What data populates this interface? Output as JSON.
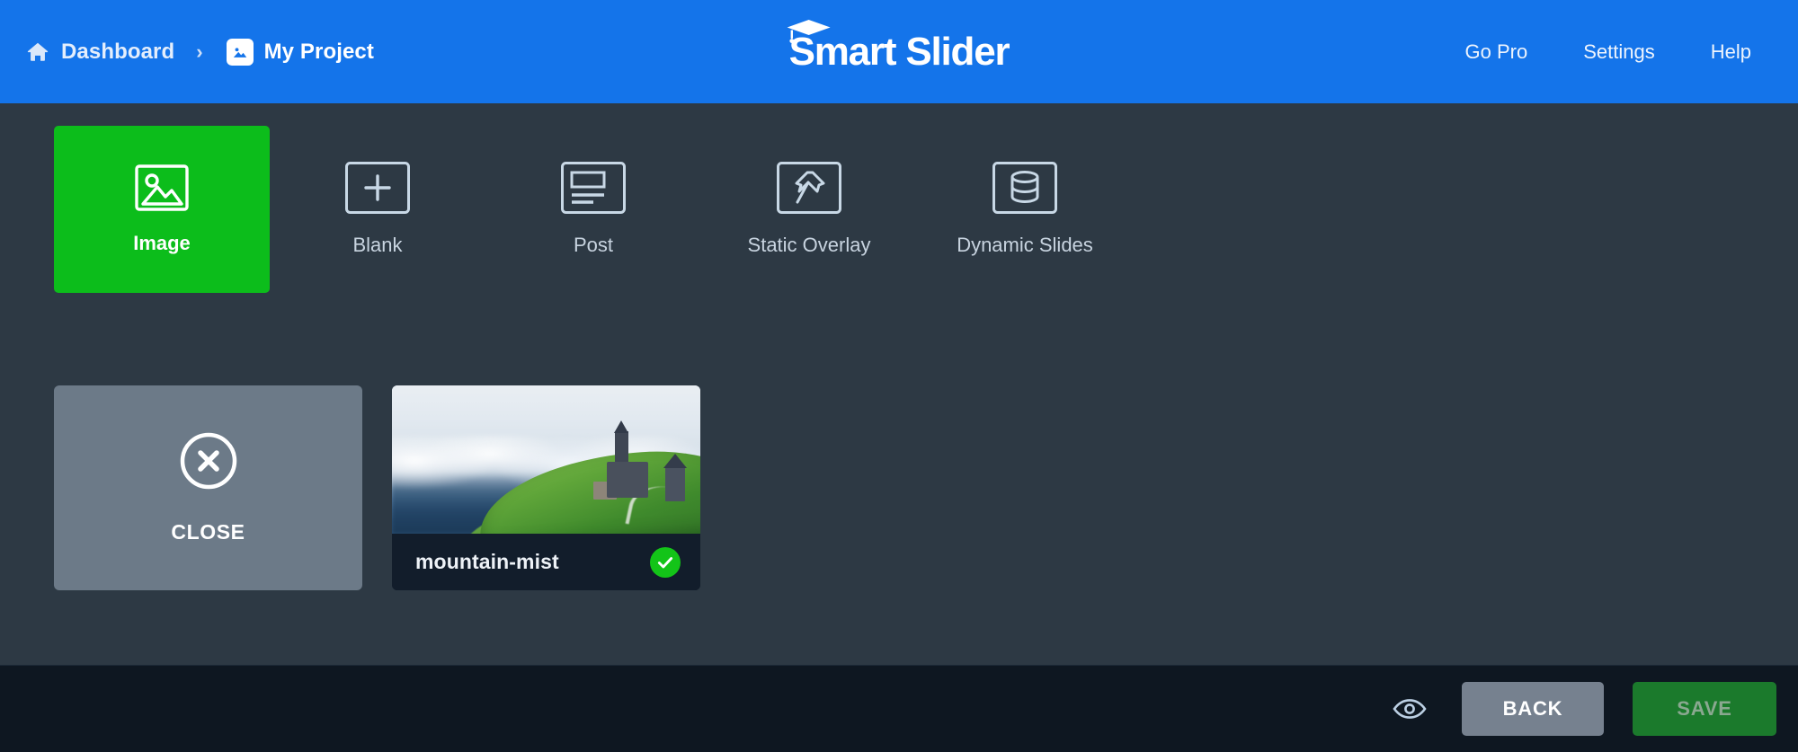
{
  "header": {
    "breadcrumb": {
      "home_icon": "home-icon",
      "home_label": "Dashboard",
      "separator": "›",
      "project_icon": "image-icon",
      "project_label": "My Project"
    },
    "logo": {
      "text": "Smart Slider",
      "cap_icon": "graduation-cap-icon"
    },
    "nav": [
      {
        "label": "Go Pro",
        "name": "go-pro"
      },
      {
        "label": "Settings",
        "name": "settings"
      },
      {
        "label": "Help",
        "name": "help"
      }
    ],
    "colors": {
      "background": "#1474ea",
      "text": "#ffffff"
    }
  },
  "slide_types": [
    {
      "label": "Image",
      "icon": "picture-icon",
      "active": true
    },
    {
      "label": "Blank",
      "icon": "plus-icon",
      "active": false
    },
    {
      "label": "Post",
      "icon": "post-layout-icon",
      "active": false
    },
    {
      "label": "Static Overlay",
      "icon": "pushpin-icon",
      "active": false
    },
    {
      "label": "Dynamic Slides",
      "icon": "database-icon",
      "active": false
    }
  ],
  "cards": {
    "close": {
      "label": "CLOSE",
      "icon": "close-circle-icon"
    },
    "slides": [
      {
        "name": "mountain-mist",
        "selected": true,
        "check_icon": "check-circle-icon",
        "thumbnail_alt": "misty mountain with hilltop church"
      }
    ]
  },
  "footer": {
    "preview_icon": "eye-icon",
    "back_label": "BACK",
    "save_label": "SAVE"
  },
  "colors": {
    "accent_blue": "#1474ea",
    "accent_green": "#0cbd1b",
    "save_green": "#1b7a2c",
    "page_background": "#2d3944",
    "footer_background": "#0e1721",
    "card_gray": "#6c7a88",
    "thumb_bar": "#121d2b"
  }
}
